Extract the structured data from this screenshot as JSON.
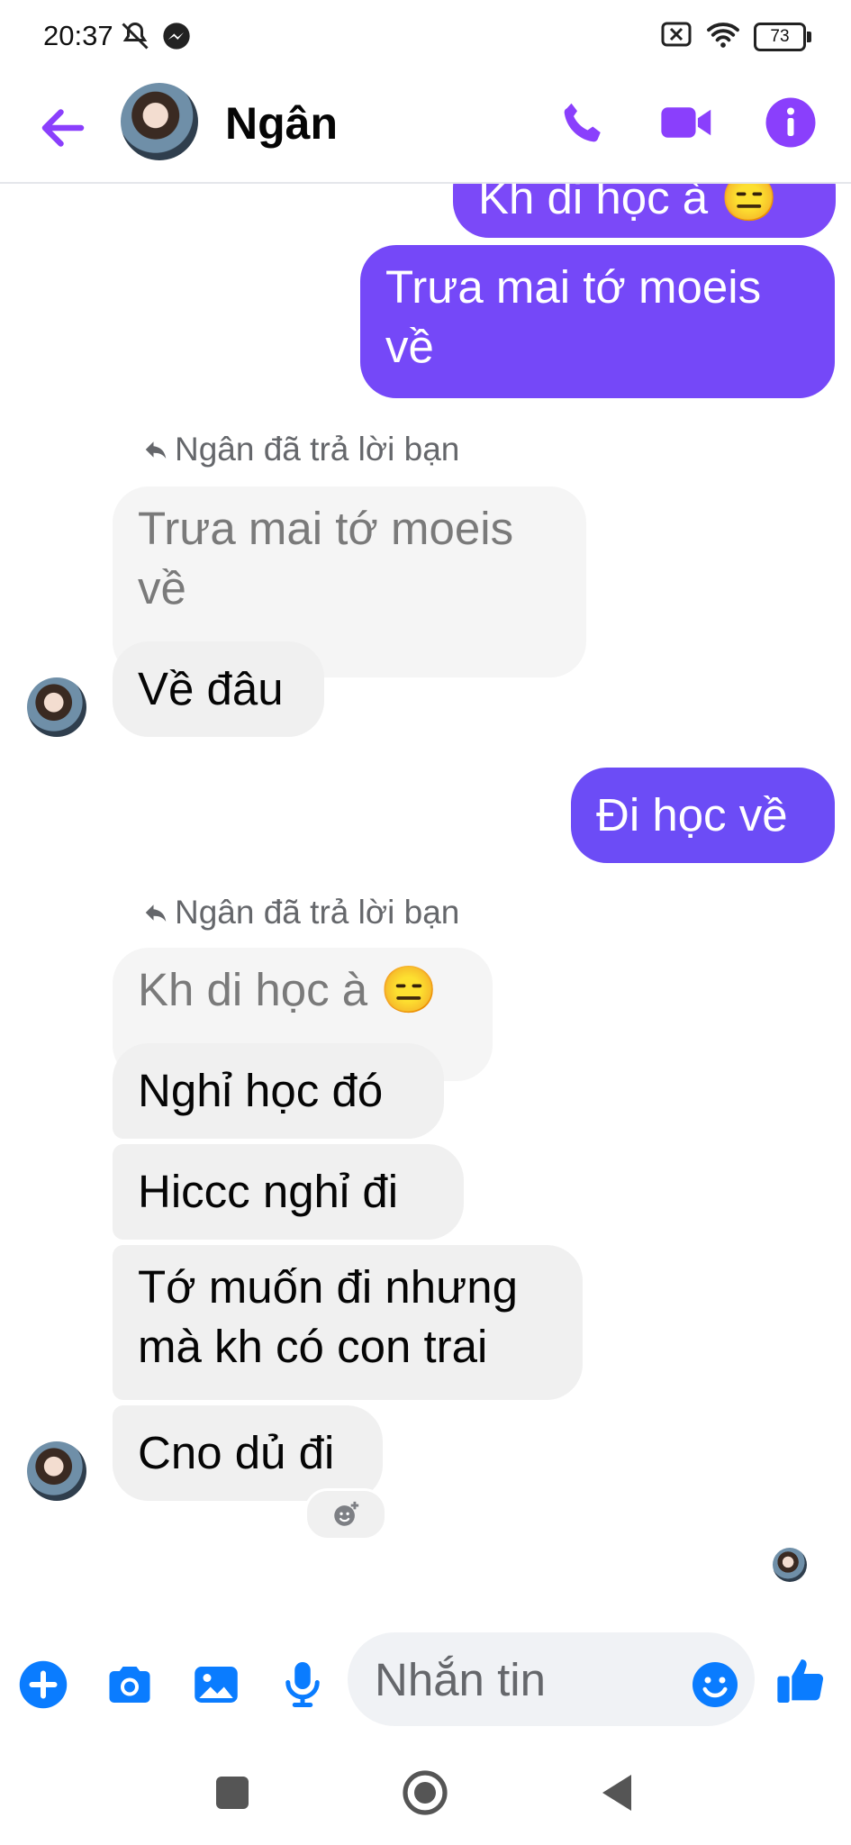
{
  "status": {
    "time": "20:37",
    "battery": "73"
  },
  "header": {
    "name": "Ngân"
  },
  "colors": {
    "accent": "#8a3ffc",
    "outgoing_top": "#7b49f8",
    "outgoing_bottom": "#6c4cf6",
    "blue": "#0a7cff"
  },
  "messages": [
    {
      "side": "out",
      "text": "Kh di học à 😑"
    },
    {
      "side": "out",
      "text": "Trưa mai tớ moeis về"
    },
    {
      "side": "in",
      "reply_note": "Ngân đã trả lời bạn",
      "quoted": "Trưa mai tớ moeis về",
      "text": "Về đâu"
    },
    {
      "side": "out",
      "text": "Đi học về"
    },
    {
      "side": "in",
      "reply_note": "Ngân đã trả lời bạn",
      "quoted": "Kh di học à 😑",
      "text": "Nghỉ học đó"
    },
    {
      "side": "in",
      "text": "Hiccc nghỉ đi"
    },
    {
      "side": "in",
      "text": "Tớ muốn đi nhưng mà kh có con trai"
    },
    {
      "side": "in",
      "text": "Cno dủ đi"
    }
  ],
  "composer": {
    "placeholder": "Nhắn tin"
  },
  "icons": [
    "back-arrow-icon",
    "phone-icon",
    "video-icon",
    "info-icon",
    "plus-icon",
    "camera-icon",
    "gallery-icon",
    "microphone-icon",
    "emoji-icon",
    "thumbs-up-icon",
    "add-reaction-icon",
    "nav-square-icon",
    "nav-home-icon",
    "nav-back-icon"
  ]
}
